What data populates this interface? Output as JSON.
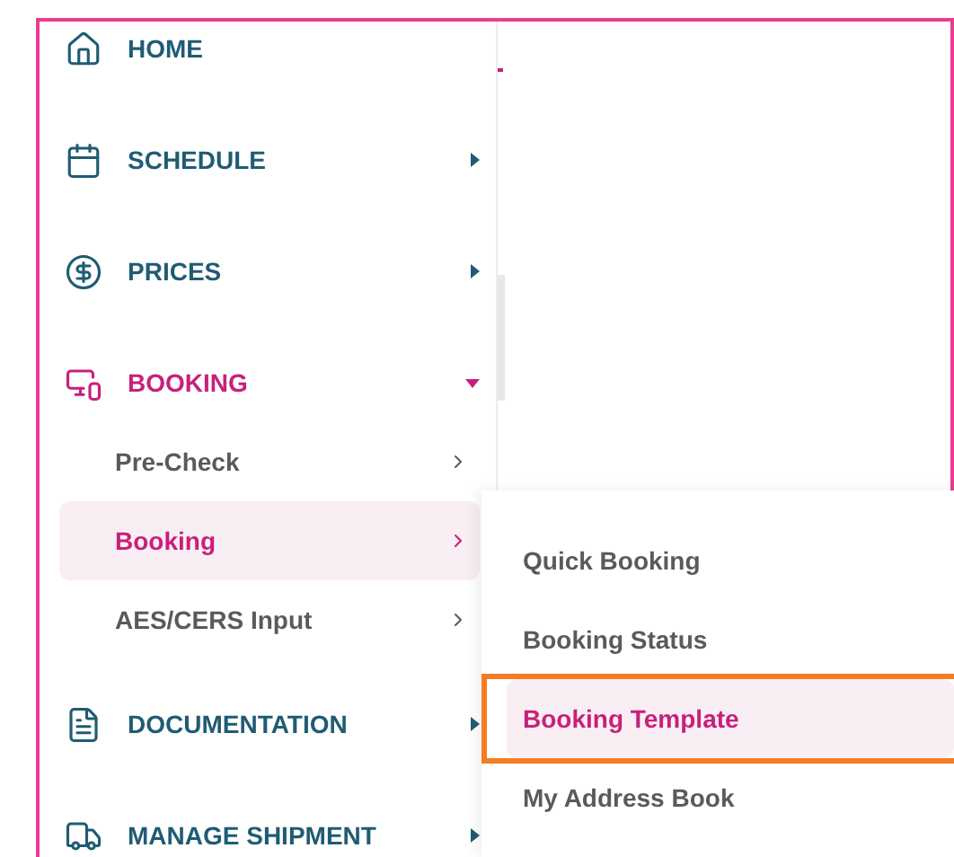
{
  "menu": [
    {
      "label": "HOME"
    },
    {
      "label": "SCHEDULE",
      "expanded": false
    },
    {
      "label": "PRICES",
      "expanded": false
    },
    {
      "label": "BOOKING",
      "expanded": true,
      "children": [
        {
          "label": "Pre-Check",
          "selected": false
        },
        {
          "label": "Booking",
          "selected": true
        },
        {
          "label": "AES/CERS Input",
          "selected": false
        }
      ]
    },
    {
      "label": "DOCUMENTATION",
      "expanded": false
    },
    {
      "label": "MANAGE SHIPMENT",
      "expanded": false
    }
  ],
  "flyout": [
    {
      "label": "Quick Booking",
      "selected": false,
      "outlined": false
    },
    {
      "label": "Booking Status",
      "selected": false,
      "outlined": false
    },
    {
      "label": "Booking Template",
      "selected": true,
      "outlined": true
    },
    {
      "label": "My Address Book",
      "selected": false,
      "outlined": false
    }
  ]
}
